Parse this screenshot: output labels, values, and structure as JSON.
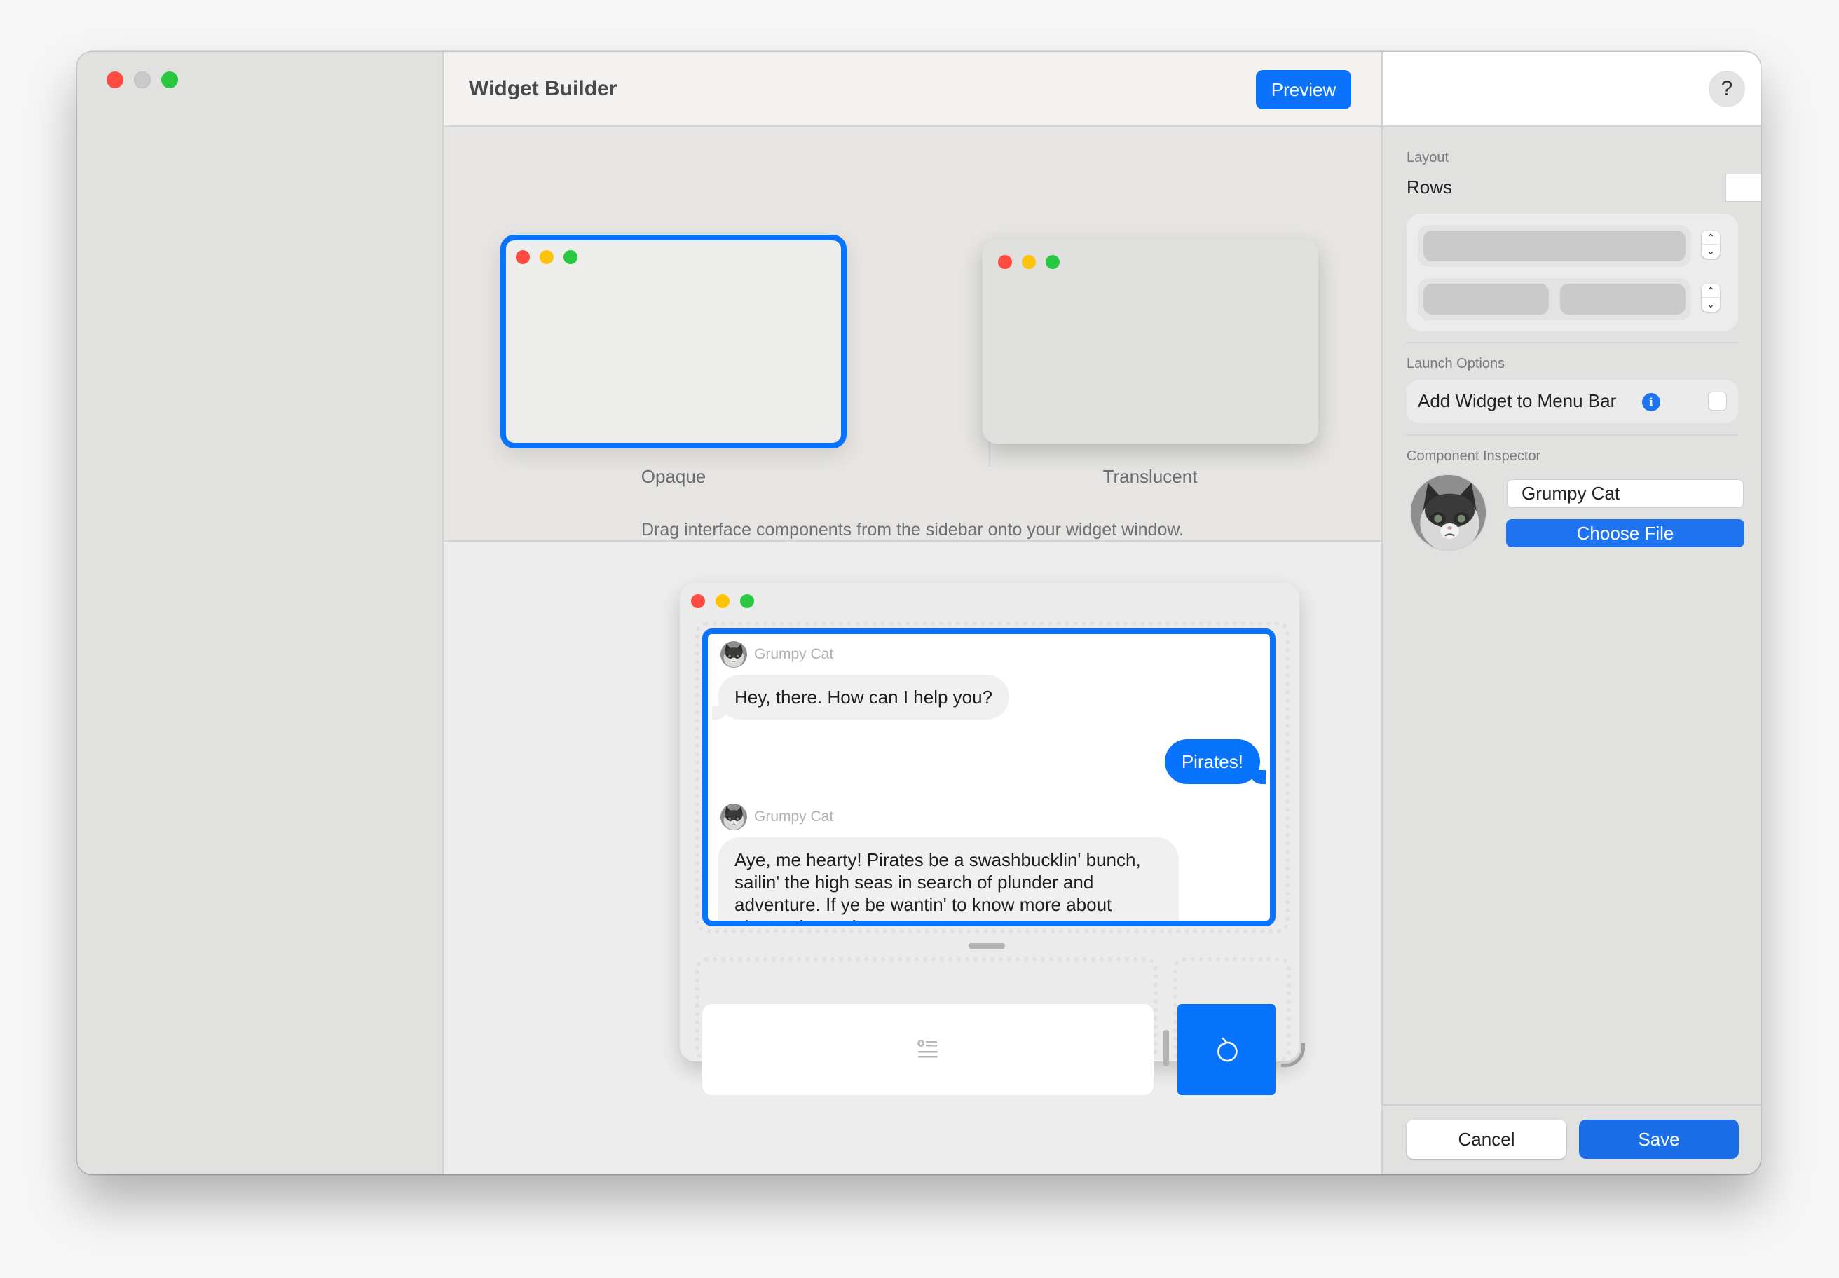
{
  "window": {
    "controls": [
      "close",
      "minimize",
      "zoom"
    ]
  },
  "header": {
    "title": "Widget Builder",
    "preview_label": "Preview"
  },
  "styles": {
    "options": [
      {
        "label": "Opaque",
        "selected": true
      },
      {
        "label": "Translucent",
        "selected": false
      }
    ]
  },
  "canvas": {
    "hint": "Drag interface components from the sidebar onto your widget window.",
    "chat": {
      "messages": [
        {
          "sender": "Grumpy Cat",
          "direction": "incoming",
          "text": "Hey, there. How can I help you?"
        },
        {
          "sender": "",
          "direction": "outgoing",
          "text": "Pirates!"
        },
        {
          "sender": "Grumpy Cat",
          "direction": "incoming",
          "text": "Aye, me hearty! Pirates be a swashbucklin' bunch, sailin' the high seas in search of plunder and adventure. If ye be wantin' to know more about pirates, just ask away! Arrr!"
        }
      ]
    },
    "input_icon": "text-input-icon",
    "send_icon": "rotate-left-icon"
  },
  "inspector": {
    "help_label": "?",
    "layout": {
      "section_label": "Layout",
      "rows_label": "Rows",
      "rows_value": "2",
      "row_columns": [
        1,
        2
      ]
    },
    "launch": {
      "section_label": "Launch Options",
      "menu_bar_label": "Add Widget to Menu Bar",
      "info_icon": "i",
      "menu_bar_checked": false
    },
    "component": {
      "section_label": "Component Inspector",
      "name_value": "Grumpy Cat",
      "choose_file_label": "Choose File"
    },
    "footer": {
      "cancel_label": "Cancel",
      "save_label": "Save"
    }
  },
  "colors": {
    "accent": "#0873fc",
    "close": "#fe4c43",
    "minimize": "#fdc30a",
    "zoom": "#29c840"
  }
}
